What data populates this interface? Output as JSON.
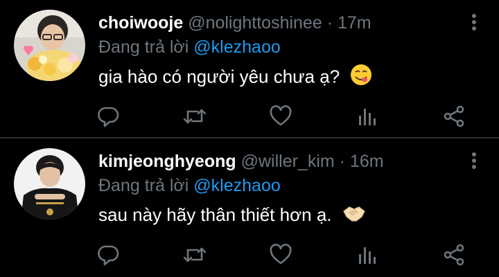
{
  "colors": {
    "background": "#000000",
    "primary_text": "#ffffff",
    "secondary_text": "#6e767d",
    "mention": "#1d9bf0",
    "divider": "#2f3336"
  },
  "tweets": [
    {
      "display_name": "choiwooje",
      "handle": "@nolighttoshinee",
      "separator": "·",
      "time": "17m",
      "reply_label": "Đang trả lời",
      "reply_to": "@klezhaoo",
      "text": "gia hào có người yêu chưa ạ?",
      "emoji": "face-savoring-food-emoji",
      "actions": [
        "reply-icon",
        "retweet-icon",
        "like-icon",
        "analytics-icon",
        "share-icon"
      ]
    },
    {
      "display_name": "kimjeonghyeong",
      "handle": "@willer_kim",
      "separator": "·",
      "time": "16m",
      "reply_label": "Đang trả lời",
      "reply_to": "@klezhaoo",
      "text": "sau này hãy thân thiết hơn ạ.",
      "emoji": "handshake-emoji",
      "actions": [
        "reply-icon",
        "retweet-icon",
        "like-icon",
        "analytics-icon",
        "share-icon"
      ]
    }
  ]
}
